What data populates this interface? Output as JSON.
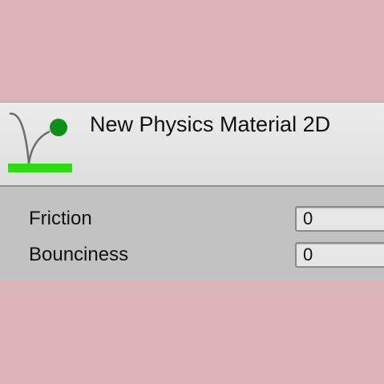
{
  "asset": {
    "title": "New Physics Material 2D",
    "icon": "physics-material-2d-icon",
    "icon_colors": {
      "ball": "#0f8f1a",
      "ground": "#2ddc11",
      "arc": "#6e6e6e"
    }
  },
  "properties": [
    {
      "label": "Friction",
      "value": "0"
    },
    {
      "label": "Bounciness",
      "value": "0"
    }
  ],
  "colors": {
    "background": "#dcb4b5",
    "header": "#e6e6e6",
    "body": "#c2c2c2"
  }
}
